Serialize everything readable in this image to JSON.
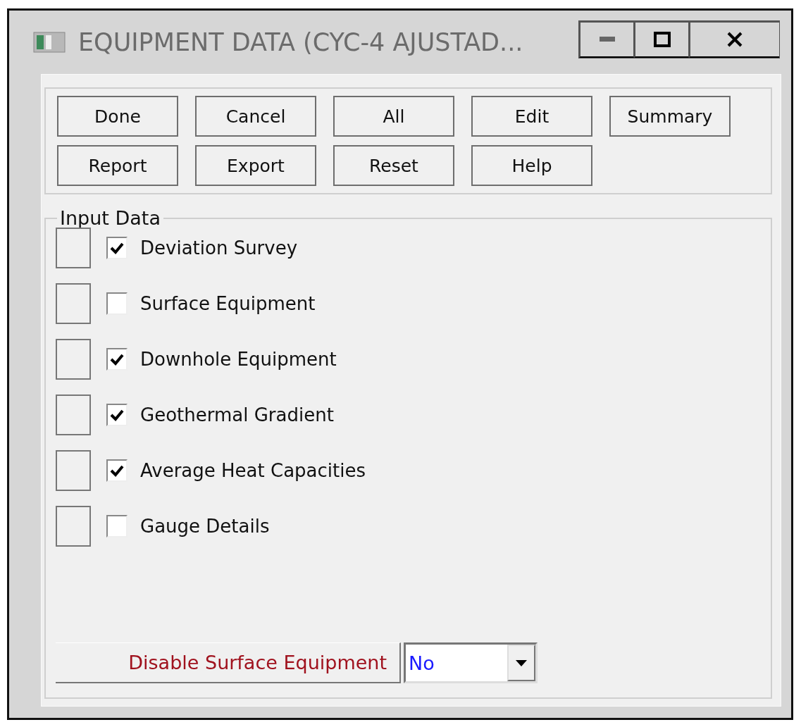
{
  "window": {
    "title": "EQUIPMENT DATA (CYC-4 AJUSTAD..."
  },
  "buttons": [
    [
      "Done",
      "Cancel",
      "All",
      "Edit",
      "Summary"
    ],
    [
      "Report",
      "Export",
      "Reset",
      "Help"
    ]
  ],
  "input_data": {
    "legend": "Input Data",
    "items": [
      {
        "label": "Deviation Survey",
        "checked": true
      },
      {
        "label": "Surface Equipment",
        "checked": false
      },
      {
        "label": "Downhole Equipment",
        "checked": true
      },
      {
        "label": "Geothermal Gradient",
        "checked": true
      },
      {
        "label": "Average Heat Capacities",
        "checked": true
      },
      {
        "label": "Gauge Details",
        "checked": false
      }
    ]
  },
  "disable_surface_equipment": {
    "label": "Disable Surface Equipment",
    "value": "No"
  }
}
